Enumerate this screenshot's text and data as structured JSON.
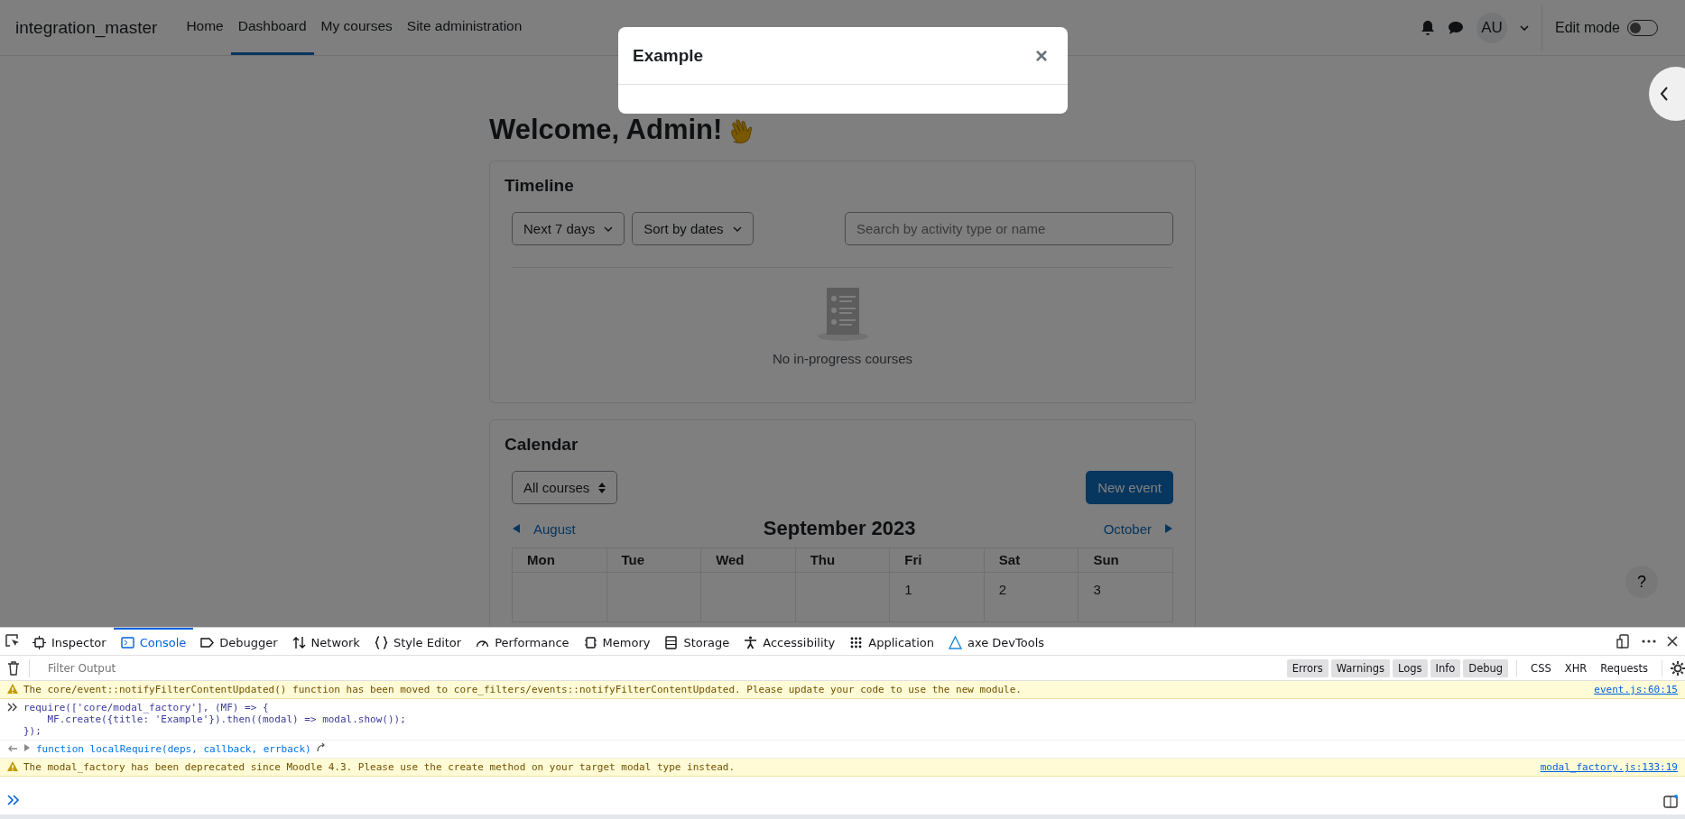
{
  "navbar": {
    "site_name": "integration_master",
    "items": [
      {
        "label": "Home",
        "selected": false
      },
      {
        "label": "Dashboard",
        "selected": true
      },
      {
        "label": "My courses",
        "selected": false
      },
      {
        "label": "Site administration",
        "selected": false
      }
    ],
    "avatar": "AU",
    "edit_mode": {
      "label": "Edit mode",
      "on": false
    }
  },
  "modal": {
    "title": "Example",
    "close": "×"
  },
  "page": {
    "heading": "Welcome, Admin!",
    "timeline": {
      "title": "Timeline",
      "filters": [
        "Next 7 days",
        "Sort by dates"
      ],
      "search_placeholder": "Search by activity type or name",
      "empty_text": "No in-progress courses"
    },
    "calendar": {
      "title": "Calendar",
      "course_select": "All courses",
      "new_event": "New event",
      "prev": "August",
      "next": "October",
      "month": "September 2023",
      "weekdays": [
        "Mon",
        "Tue",
        "Wed",
        "Thu",
        "Fri",
        "Sat",
        "Sun"
      ],
      "first_week": [
        {
          "kind": "blank"
        },
        {
          "kind": "blank"
        },
        {
          "kind": "blank"
        },
        {
          "kind": "blank"
        },
        {
          "kind": "day",
          "day": "1"
        },
        {
          "kind": "day",
          "day": "2"
        },
        {
          "kind": "day",
          "day": "3"
        }
      ]
    },
    "help": "?"
  },
  "devtools": {
    "tabs": [
      {
        "label": "Inspector",
        "selected": false
      },
      {
        "label": "Console",
        "selected": true
      },
      {
        "label": "Debugger",
        "selected": false
      },
      {
        "label": "Network",
        "selected": false
      },
      {
        "label": "Style Editor",
        "selected": false
      },
      {
        "label": "Performance",
        "selected": false
      },
      {
        "label": "Memory",
        "selected": false
      },
      {
        "label": "Storage",
        "selected": false
      },
      {
        "label": "Accessibility",
        "selected": false
      },
      {
        "label": "Application",
        "selected": false
      },
      {
        "label": "axe DevTools",
        "selected": false
      }
    ],
    "filter_placeholder": "Filter Output",
    "levels": [
      {
        "label": "Errors",
        "selected": true
      },
      {
        "label": "Warnings",
        "selected": true
      },
      {
        "label": "Logs",
        "selected": true
      },
      {
        "label": "Info",
        "selected": true
      },
      {
        "label": "Debug",
        "selected": true
      }
    ],
    "types": [
      {
        "label": "CSS",
        "selected": false
      },
      {
        "label": "XHR",
        "selected": false
      },
      {
        "label": "Requests",
        "selected": false
      }
    ],
    "messages": [
      {
        "kind": "warning",
        "text": "The core/event::notifyFilterContentUpdated() function has been moved to core_filters/events::notifyFilterContentUpdated. Please update your code to use the new module.",
        "source": "event.js:60:15"
      },
      {
        "kind": "input",
        "lines": [
          "require(['core/modal_factory'], (MF) => {",
          "    MF.create({title: 'Example'}).then((modal) => modal.show());",
          "});"
        ]
      },
      {
        "kind": "result",
        "text": "function localRequire(deps, callback, errback)"
      },
      {
        "kind": "warning",
        "text": "The modal_factory has been deprecated since Moodle 4.3. Please use the create method on your target modal type instead.",
        "source": "modal_factory.js:133:19"
      }
    ]
  }
}
